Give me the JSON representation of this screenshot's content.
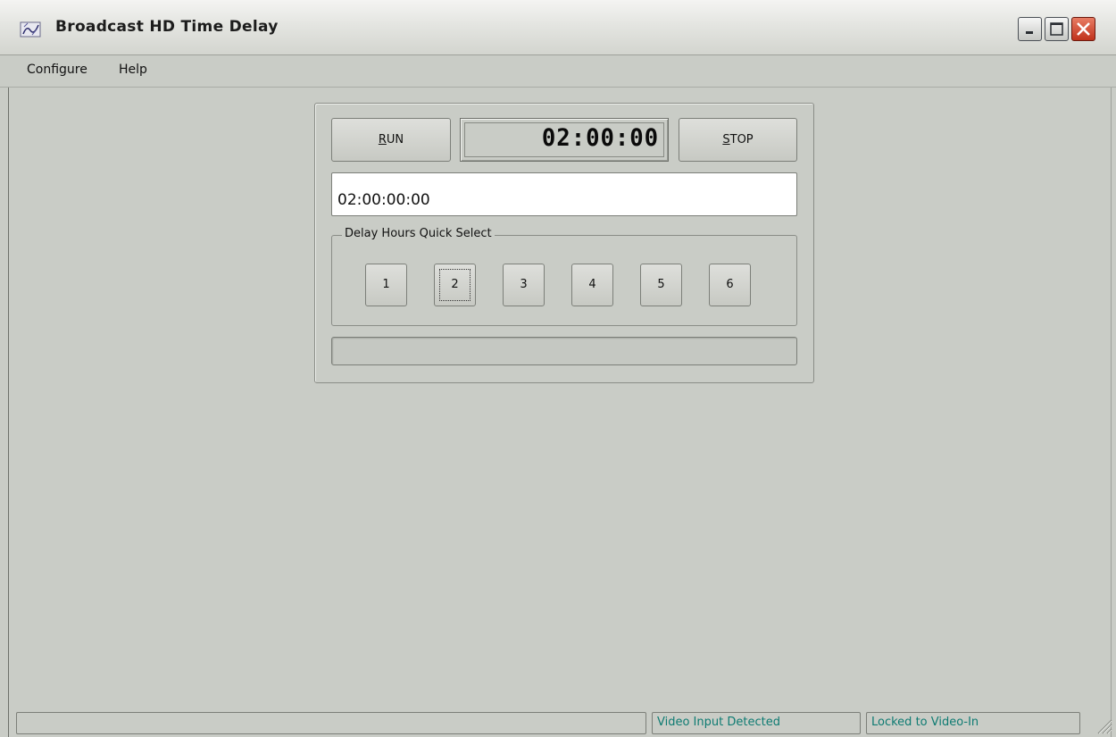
{
  "window": {
    "title": "Broadcast HD Time Delay",
    "icon": "app-icon"
  },
  "menu": {
    "items": [
      "Configure",
      "Help"
    ]
  },
  "controls": {
    "run_label_accel": "R",
    "run_label_rest": "UN",
    "stop_label_accel": "S",
    "stop_label_rest": "TOP",
    "display": "02:00:00",
    "time_value": "02:00:00:00"
  },
  "quick_select": {
    "label": "Delay Hours Quick Select",
    "buttons": [
      "1",
      "2",
      "3",
      "4",
      "5",
      "6"
    ],
    "focused": "2"
  },
  "status": {
    "input": "Video Input Detected",
    "lock": "Locked to Video-In",
    "color": "#0e7b72"
  },
  "colors": {
    "background": "#c9ccc6",
    "close_button": "#c0321b"
  }
}
